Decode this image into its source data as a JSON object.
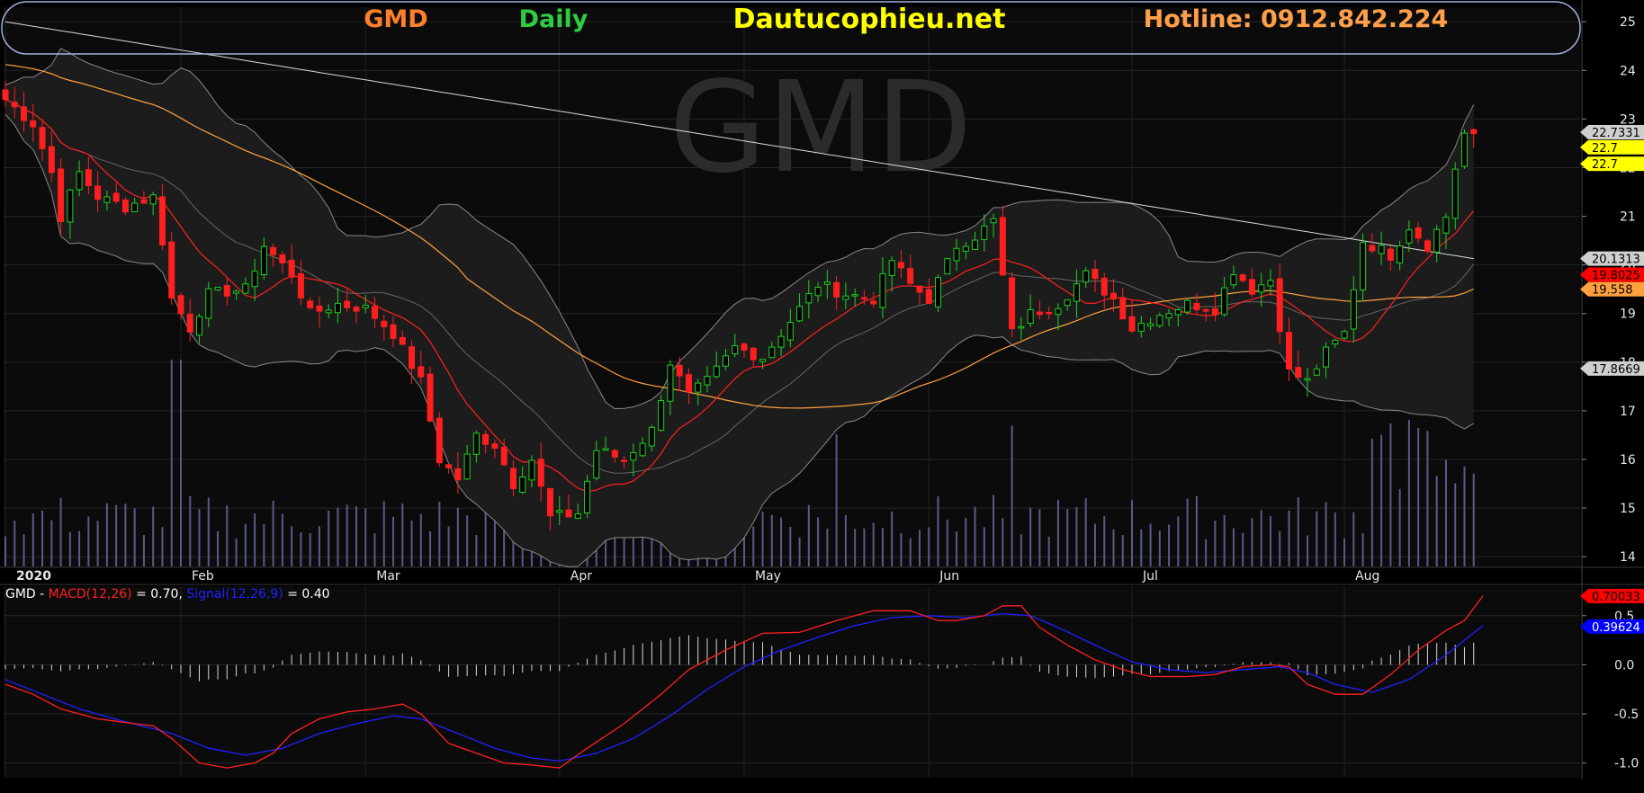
{
  "header": {
    "ticker": "GMD",
    "period": "Daily",
    "site": "Dautucophieu.net",
    "hotline": "Hotline: 0912.842.224",
    "watermark": "GMD",
    "colors": {
      "ticker": "#ff7f2a",
      "period": "#2ecc40",
      "site": "#ffff00",
      "hotline": "#ff9f4a"
    }
  },
  "chart_data": [
    {
      "type": "candlestick",
      "name": "price",
      "x_axis": {
        "labels": [
          {
            "text": "2020",
            "day": 0,
            "bold": true
          },
          {
            "text": "Feb",
            "day": 19
          },
          {
            "text": "Mar",
            "day": 39
          },
          {
            "text": "Apr",
            "day": 60
          },
          {
            "text": "May",
            "day": 80
          },
          {
            "text": "Jun",
            "day": 100
          },
          {
            "text": "Jul",
            "day": 122
          },
          {
            "text": "Aug",
            "day": 145
          }
        ],
        "days": 160
      },
      "y_axis": {
        "ylim": [
          13.8,
          25.3
        ],
        "ticks": [
          14,
          15,
          16,
          17,
          18,
          19,
          20,
          21,
          22,
          23,
          24,
          25
        ],
        "tick_labels": [
          "14",
          "15",
          "16",
          "17",
          "18",
          "19",
          "20",
          "21",
          "22",
          "23",
          "24",
          "25"
        ]
      },
      "price_labels": [
        {
          "text": "22.7331",
          "value": 22.73,
          "bg": "#cfcfcf",
          "fg": "#000"
        },
        {
          "text": "22.7",
          "value": 22.42,
          "bg": "#ffff00",
          "fg": "#000"
        },
        {
          "text": "22.7",
          "value": 22.08,
          "bg": "#ffff00",
          "fg": "#000"
        },
        {
          "text": "20.1313",
          "value": 20.13,
          "bg": "#cfcfcf",
          "fg": "#000"
        },
        {
          "text": "19.8025",
          "value": 19.8,
          "bg": "#ff0000",
          "fg": "#000"
        },
        {
          "text": "19.558",
          "value": 19.5,
          "bg": "#ffa040",
          "fg": "#000"
        },
        {
          "text": "17.8669",
          "value": 17.87,
          "bg": "#cfcfcf",
          "fg": "#000"
        }
      ],
      "close_anchors": [
        [
          0,
          23.4
        ],
        [
          3,
          22.9
        ],
        [
          5,
          21.9
        ],
        [
          6,
          21.0
        ],
        [
          8,
          21.9
        ],
        [
          10,
          21.4
        ],
        [
          13,
          21.2
        ],
        [
          16,
          21.4
        ],
        [
          17,
          20.5
        ],
        [
          18,
          19.3
        ],
        [
          20,
          18.7
        ],
        [
          22,
          19.4
        ],
        [
          26,
          19.5
        ],
        [
          28,
          20.4
        ],
        [
          31,
          19.8
        ],
        [
          33,
          19.0
        ],
        [
          36,
          19.2
        ],
        [
          39,
          19.1
        ],
        [
          42,
          18.6
        ],
        [
          45,
          17.6
        ],
        [
          47,
          16.0
        ],
        [
          49,
          15.6
        ],
        [
          51,
          16.5
        ],
        [
          53,
          16.3
        ],
        [
          55,
          15.5
        ],
        [
          57,
          16.0
        ],
        [
          59,
          14.8
        ],
        [
          62,
          14.9
        ],
        [
          64,
          16.2
        ],
        [
          67,
          16.0
        ],
        [
          70,
          16.6
        ],
        [
          72,
          18.0
        ],
        [
          74,
          17.3
        ],
        [
          76,
          17.6
        ],
        [
          79,
          18.3
        ],
        [
          82,
          18.1
        ],
        [
          86,
          19.1
        ],
        [
          88,
          19.6
        ],
        [
          91,
          19.4
        ],
        [
          94,
          19.3
        ],
        [
          96,
          20.1
        ],
        [
          98,
          19.6
        ],
        [
          100,
          19.3
        ],
        [
          103,
          20.4
        ],
        [
          105,
          20.6
        ],
        [
          107,
          20.9
        ],
        [
          109,
          18.6
        ],
        [
          111,
          19.0
        ],
        [
          114,
          19.2
        ],
        [
          117,
          19.8
        ],
        [
          120,
          19.3
        ],
        [
          122,
          18.7
        ],
        [
          125,
          19.0
        ],
        [
          128,
          19.2
        ],
        [
          131,
          19.1
        ],
        [
          133,
          19.9
        ],
        [
          135,
          19.5
        ],
        [
          137,
          19.7
        ],
        [
          139,
          17.8
        ],
        [
          141,
          17.6
        ],
        [
          143,
          18.2
        ],
        [
          145,
          18.6
        ],
        [
          147,
          20.5
        ],
        [
          150,
          20.2
        ],
        [
          152,
          20.8
        ],
        [
          154,
          20.4
        ],
        [
          156,
          21.0
        ],
        [
          157,
          22.0
        ],
        [
          158,
          22.7
        ]
      ],
      "series_styles": [
        {
          "name": "sma10",
          "color": "#ff2020"
        },
        {
          "name": "sma50",
          "color": "#ffa040"
        },
        {
          "name": "sma200",
          "color": "#d8d8d8"
        },
        {
          "name": "bollinger",
          "color": "#888888"
        }
      ],
      "up_color": "#1fd21f",
      "down_color": "#ff1f1f"
    },
    {
      "type": "line",
      "name": "macd",
      "legend": {
        "prefix": "GMD - ",
        "macd_label": "MACD(12,26)",
        "macd_value": " = 0.70, ",
        "signal_label": "Signal(12,26,9)",
        "signal_value": " = 0.40"
      },
      "y_axis": {
        "ylim": [
          -1.15,
          0.8
        ],
        "ticks": [
          -1.0,
          -0.5,
          0.0,
          0.5
        ],
        "tick_labels": [
          "-1.0",
          "-0.5",
          "0.0",
          "0.5"
        ]
      },
      "price_labels": [
        {
          "text": "0.70033",
          "value": 0.7,
          "bg": "#ff0000",
          "fg": "#000"
        },
        {
          "text": "0.39624",
          "value": 0.39,
          "bg": "#0000ff",
          "fg": "#fff"
        }
      ],
      "macd": [
        [
          0,
          -0.2
        ],
        [
          3,
          -0.3
        ],
        [
          6,
          -0.45
        ],
        [
          10,
          -0.55
        ],
        [
          14,
          -0.6
        ],
        [
          16,
          -0.62
        ],
        [
          18,
          -0.75
        ],
        [
          21,
          -1.0
        ],
        [
          24,
          -1.05
        ],
        [
          27,
          -1.0
        ],
        [
          29,
          -0.9
        ],
        [
          31,
          -0.7
        ],
        [
          34,
          -0.55
        ],
        [
          37,
          -0.48
        ],
        [
          40,
          -0.45
        ],
        [
          43,
          -0.4
        ],
        [
          45,
          -0.5
        ],
        [
          48,
          -0.8
        ],
        [
          51,
          -0.9
        ],
        [
          54,
          -1.0
        ],
        [
          57,
          -1.02
        ],
        [
          60,
          -1.05
        ],
        [
          63,
          -0.85
        ],
        [
          67,
          -0.6
        ],
        [
          71,
          -0.3
        ],
        [
          74,
          -0.05
        ],
        [
          78,
          0.15
        ],
        [
          82,
          0.32
        ],
        [
          86,
          0.33
        ],
        [
          90,
          0.45
        ],
        [
          94,
          0.55
        ],
        [
          98,
          0.55
        ],
        [
          101,
          0.45
        ],
        [
          103,
          0.45
        ],
        [
          106,
          0.5
        ],
        [
          108,
          0.6
        ],
        [
          110,
          0.6
        ],
        [
          112,
          0.38
        ],
        [
          115,
          0.2
        ],
        [
          118,
          0.05
        ],
        [
          121,
          -0.05
        ],
        [
          124,
          -0.12
        ],
        [
          128,
          -0.12
        ],
        [
          131,
          -0.1
        ],
        [
          134,
          -0.02
        ],
        [
          137,
          0.0
        ],
        [
          139,
          -0.02
        ],
        [
          141,
          -0.2
        ],
        [
          144,
          -0.3
        ],
        [
          147,
          -0.3
        ],
        [
          150,
          -0.1
        ],
        [
          153,
          0.15
        ],
        [
          156,
          0.35
        ],
        [
          158,
          0.45
        ],
        [
          160,
          0.7
        ]
      ],
      "signal": [
        [
          0,
          -0.15
        ],
        [
          4,
          -0.3
        ],
        [
          8,
          -0.45
        ],
        [
          13,
          -0.58
        ],
        [
          18,
          -0.7
        ],
        [
          22,
          -0.85
        ],
        [
          26,
          -0.92
        ],
        [
          30,
          -0.85
        ],
        [
          34,
          -0.7
        ],
        [
          38,
          -0.6
        ],
        [
          42,
          -0.52
        ],
        [
          45,
          -0.55
        ],
        [
          49,
          -0.7
        ],
        [
          53,
          -0.85
        ],
        [
          57,
          -0.95
        ],
        [
          60,
          -0.98
        ],
        [
          64,
          -0.9
        ],
        [
          68,
          -0.75
        ],
        [
          72,
          -0.52
        ],
        [
          76,
          -0.25
        ],
        [
          80,
          -0.02
        ],
        [
          84,
          0.15
        ],
        [
          88,
          0.28
        ],
        [
          92,
          0.4
        ],
        [
          96,
          0.48
        ],
        [
          100,
          0.5
        ],
        [
          104,
          0.48
        ],
        [
          108,
          0.52
        ],
        [
          111,
          0.5
        ],
        [
          114,
          0.38
        ],
        [
          118,
          0.2
        ],
        [
          122,
          0.03
        ],
        [
          126,
          -0.05
        ],
        [
          130,
          -0.08
        ],
        [
          134,
          -0.05
        ],
        [
          138,
          -0.02
        ],
        [
          141,
          -0.08
        ],
        [
          144,
          -0.2
        ],
        [
          148,
          -0.28
        ],
        [
          152,
          -0.15
        ],
        [
          156,
          0.1
        ],
        [
          160,
          0.4
        ]
      ],
      "macd_color": "#ff2020",
      "signal_color": "#2020ff",
      "histogram_color": "#d8d8d8"
    }
  ]
}
